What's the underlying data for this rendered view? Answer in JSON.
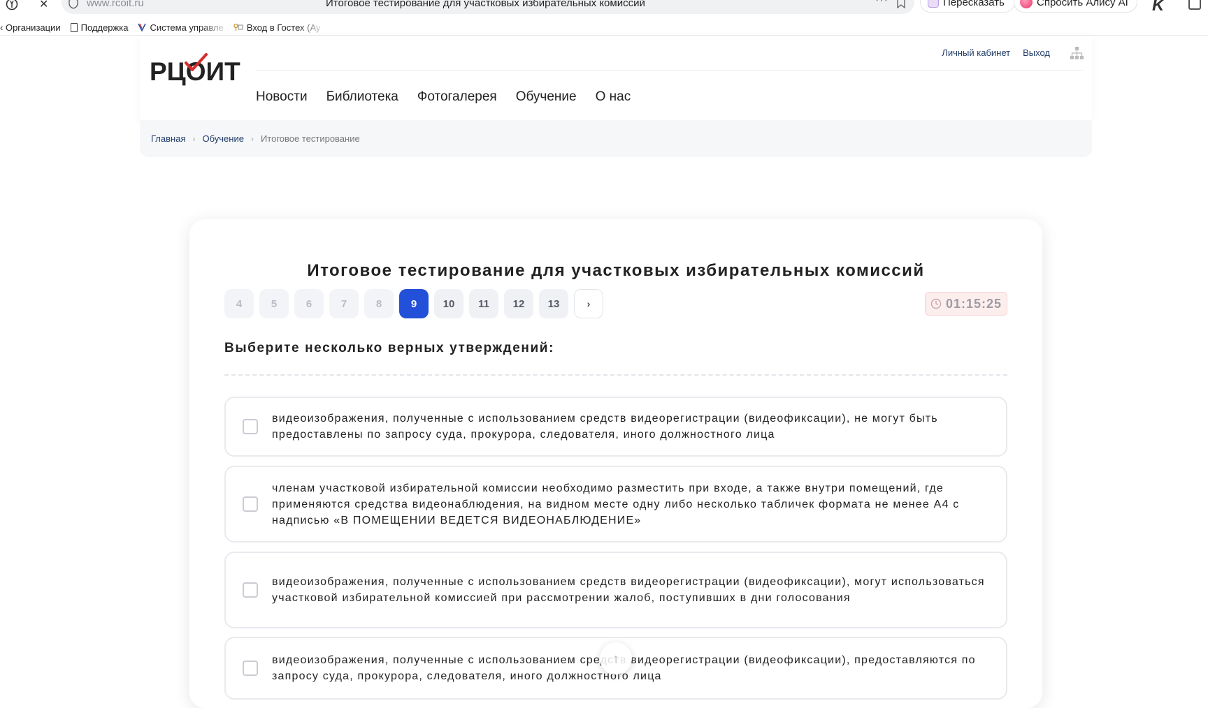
{
  "browser": {
    "url": "www.rcoit.ru",
    "tab_title": "Итоговое тестирование для участковых избирательных комиссий",
    "retell_label": "Пересказать",
    "alice_label": "Спросить Алису AI",
    "menu_dots": "···"
  },
  "bookmarks": [
    {
      "label": "Организации",
      "prefix": "‹"
    },
    {
      "label": "Поддержка"
    },
    {
      "label": "Система управле"
    },
    {
      "label": "Вход в Гостех (Ау"
    }
  ],
  "site": {
    "logo": "РЦОИТ",
    "top_links": {
      "cabinet": "Личный кабинет",
      "logout": "Выход"
    },
    "nav": [
      "Новости",
      "Библиотека",
      "Фотогалерея",
      "Обучение",
      "О нас"
    ]
  },
  "breadcrumb": {
    "home": "Главная",
    "section": "Обучение",
    "current": "Итоговое тестирование",
    "separator": "›"
  },
  "test": {
    "title": "Итоговое тестирование для участковых избирательных комиссий",
    "questions": [
      "4",
      "5",
      "6",
      "7",
      "8",
      "9",
      "10",
      "11",
      "12",
      "13"
    ],
    "current_question": "9",
    "next_label": "›",
    "timer": "01:15:25",
    "prompt": "Выберите несколько верных утверждений:",
    "options": [
      "видеоизображения, полученные с использованием средств видеорегистрации (видеофиксации), не могут быть предоставлены по запросу суда, прокурора, следователя, иного должностного лица",
      "членам участковой избирательной комиссии необходимо разместить при входе, а также внутри помещений, где применяются средства видеонаблюдения, на видном месте одну либо несколько табличек формата не менее А4 с надписью «В ПОМЕЩЕНИИ ВЕДЕТСЯ ВИДЕОНАБЛЮДЕНИЕ»",
      "видеоизображения, полученные с использованием средств видеорегистрации (видеофиксации), могут использоваться участковой избирательной комиссией при рассмотрении жалоб, поступивших в дни голосования",
      "видеоизображения, полученные с использованием средств видеорегистрации (видеофиксации), предоставляются по запросу суда, прокурора, следователя, иного должностного лица"
    ]
  },
  "colors": {
    "accent": "#2350d8",
    "logo_check": "#d62b2b",
    "link": "#1f3b66",
    "timer_bg": "#fdeeee"
  }
}
